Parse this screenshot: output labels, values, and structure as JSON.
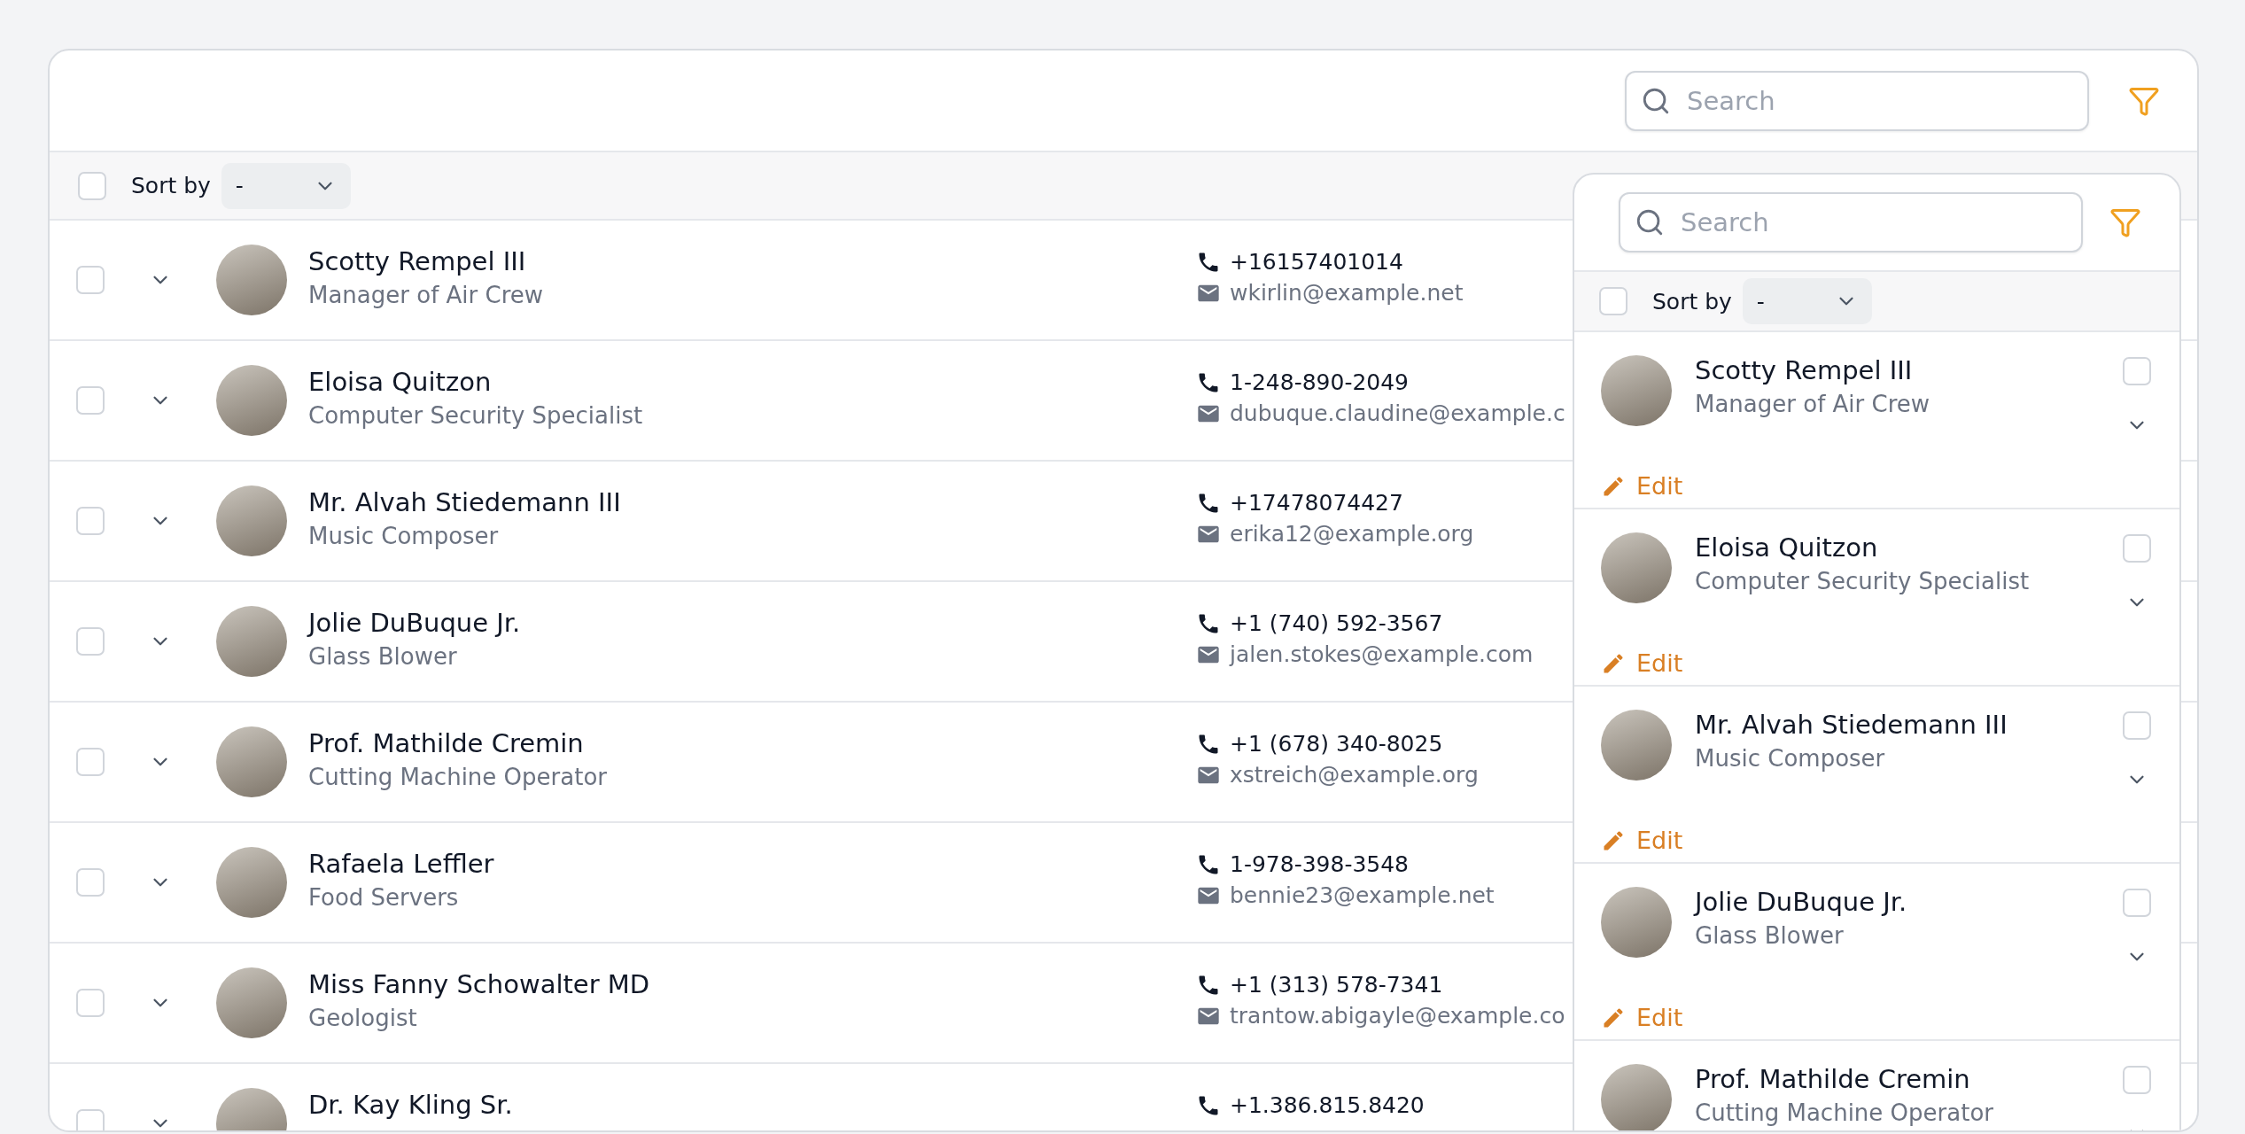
{
  "toolbar": {
    "search": {
      "placeholder": "Search"
    }
  },
  "sort_bar": {
    "checked": false,
    "label": "Sort by",
    "value": "-"
  },
  "rows": [
    {
      "checked": false,
      "name": "Scotty Rempel III",
      "title": "Manager of Air Crew",
      "phone": "+16157401014",
      "email": "wkirlin@example.net"
    },
    {
      "checked": false,
      "name": "Eloisa Quitzon",
      "title": "Computer Security Specialist",
      "phone": "1-248-890-2049",
      "email": "dubuque.claudine@example.c"
    },
    {
      "checked": false,
      "name": "Mr. Alvah Stiedemann III",
      "title": "Music Composer",
      "phone": "+17478074427",
      "email": "erika12@example.org"
    },
    {
      "checked": false,
      "name": "Jolie DuBuque Jr.",
      "title": "Glass Blower",
      "phone": "+1 (740) 592-3567",
      "email": "jalen.stokes@example.com"
    },
    {
      "checked": false,
      "name": "Prof. Mathilde Cremin",
      "title": "Cutting Machine Operator",
      "phone": "+1 (678) 340-8025",
      "email": "xstreich@example.org"
    },
    {
      "checked": false,
      "name": "Rafaela Leffler",
      "title": "Food Servers",
      "phone": "1-978-398-3548",
      "email": "bennie23@example.net"
    },
    {
      "checked": false,
      "name": "Miss Fanny Schowalter MD",
      "title": "Geologist",
      "phone": "+1 (313) 578-7341",
      "email": "trantow.abigayle@example.co"
    },
    {
      "checked": false,
      "name": "Dr. Kay Kling Sr.",
      "phone": "+1.386.815.8420"
    }
  ],
  "panel": {
    "search": {
      "placeholder": "Search"
    },
    "sort_bar": {
      "checked": false,
      "label": "Sort by",
      "value": "-"
    },
    "cards": [
      {
        "checked": false,
        "name": "Scotty Rempel III",
        "title": "Manager of Air Crew",
        "action": "Edit"
      },
      {
        "checked": false,
        "name": "Eloisa Quitzon",
        "title": "Computer Security Specialist",
        "action": "Edit"
      },
      {
        "checked": false,
        "name": "Mr. Alvah Stiedemann III",
        "title": "Music Composer",
        "action": "Edit"
      },
      {
        "checked": false,
        "name": "Jolie DuBuque Jr.",
        "title": "Glass Blower",
        "action": "Edit"
      },
      {
        "checked": false,
        "name": "Prof. Mathilde Cremin",
        "title": "Cutting Machine Operator"
      }
    ]
  }
}
